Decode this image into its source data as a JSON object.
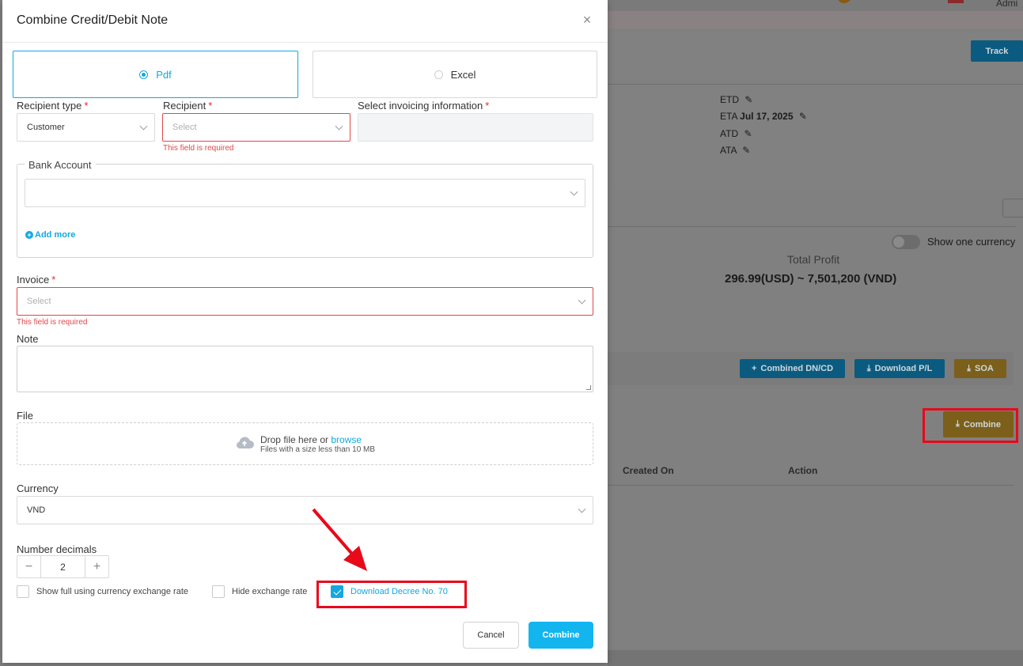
{
  "background": {
    "header_user": "Admi",
    "track_button": "Track",
    "dates": [
      {
        "label": "ETD",
        "value": ""
      },
      {
        "label": "ETA",
        "value": "Jul 17, 2025"
      },
      {
        "label": "ATD",
        "value": ""
      },
      {
        "label": "ATA",
        "value": ""
      }
    ],
    "currency_toggle_label": "Show one currency",
    "total_profit_label": "Total Profit",
    "total_profit_value": "296.99(USD) ~ 7,501,200 (VND)",
    "actions": {
      "combined": "Combined DN/CD",
      "download_pl": "Download P/L",
      "soa": "SOA",
      "combine": "Combine"
    },
    "table_headers": [
      "Created On",
      "Action"
    ],
    "colors": {
      "blue_button": "#0b5b80",
      "gold_button": "#7b5f1a"
    }
  },
  "modal": {
    "title": "Combine Credit/Debit Note",
    "formats": [
      {
        "label": "Pdf",
        "selected": true
      },
      {
        "label": "Excel",
        "selected": false
      }
    ],
    "recipient_type": {
      "label": "Recipient type",
      "required_mark": "*",
      "value": "Customer"
    },
    "recipient": {
      "label": "Recipient",
      "required_mark": "*",
      "placeholder": "Select",
      "error": "This field is required"
    },
    "invoicing_info": {
      "label": "Select invoicing information",
      "required_mark": "*"
    },
    "bank_account": {
      "legend": "Bank Account",
      "add_more": "Add more"
    },
    "invoice": {
      "label": "Invoice",
      "required_mark": "*",
      "placeholder": "Select",
      "error": "This field is required"
    },
    "note": {
      "label": "Note"
    },
    "file": {
      "label": "File",
      "drop_text": "Drop file here or ",
      "browse_text": "browse",
      "hint": "Files with a size less than 10 MB"
    },
    "currency": {
      "label": "Currency",
      "value": "VND"
    },
    "number_decimals": {
      "label": "Number decimals",
      "value": "2"
    },
    "checkboxes": [
      {
        "label": "Show full using currency exchange rate",
        "checked": false
      },
      {
        "label": "Hide exchange rate",
        "checked": false
      },
      {
        "label": "Download Decree No. 70",
        "checked": true
      }
    ],
    "buttons": {
      "cancel": "Cancel",
      "combine": "Combine"
    },
    "accent_color": "#13a8e0",
    "error_color": "#e04848"
  },
  "annotations": {
    "highlight_color": "#e8091b",
    "arrow_icon": "arrow-down-right"
  }
}
